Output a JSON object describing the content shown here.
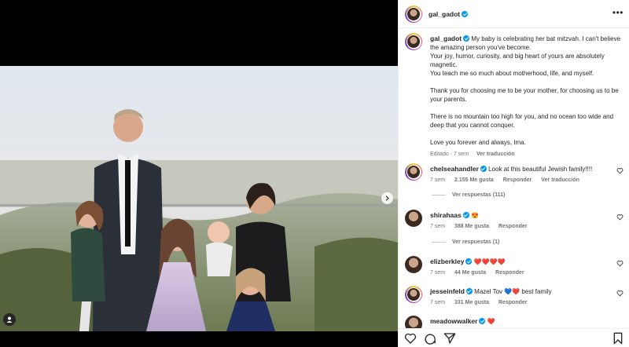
{
  "post": {
    "author": "gal_gadot",
    "caption": {
      "line1": "My baby is celebrating her bat mitzvah. I can't believe the amazing person you've become.",
      "line2": "Your joy, humor, curiosity, and big heart of yours are absolutely magnetic.",
      "line3": "You teach me so much about motherhood, life, and myself.",
      "line4": "Thank you for choosing me to be your mother, for choosing us to be your parents.",
      "line5": "There is no mountain too high for you, and no ocean too wide and deep that you cannot conquer.",
      "line6": "Love you forever and always, Ima."
    },
    "edited": "Editado · 7 sem",
    "see_translation": "Ver traducción"
  },
  "comments": [
    {
      "user": "chelseahandler",
      "text": "Look at this beautiful Jewish family!!!!",
      "time": "7 sem",
      "likes": "2.155 Me gusta",
      "reply": "Responder",
      "translate": "Ver traducción",
      "replies": "Ver respuestas (111)"
    },
    {
      "user": "shirahaas",
      "text": "😍",
      "time": "7 sem",
      "likes": "388 Me gusta",
      "reply": "Responder",
      "replies": "Ver respuestas (1)"
    },
    {
      "user": "elizberkley",
      "text": "❤️❤️❤️❤️",
      "time": "7 sem",
      "likes": "44 Me gusta",
      "reply": "Responder"
    },
    {
      "user": "jesseinfeld",
      "text": "Mazel Tov 💙❤️ best family",
      "time": "7 sem",
      "likes": "331 Me gusta",
      "reply": "Responder"
    },
    {
      "user": "meadowwalker",
      "text": "❤️"
    }
  ],
  "icons": {
    "like": "heart-icon",
    "comment": "comment-icon",
    "share": "share-icon",
    "save": "bookmark-icon",
    "next": "chevron-right-icon",
    "tag": "user-tag-icon"
  },
  "colors": {
    "verified": "#0095f6",
    "heart": "#ed4956",
    "muted": "#737373"
  }
}
